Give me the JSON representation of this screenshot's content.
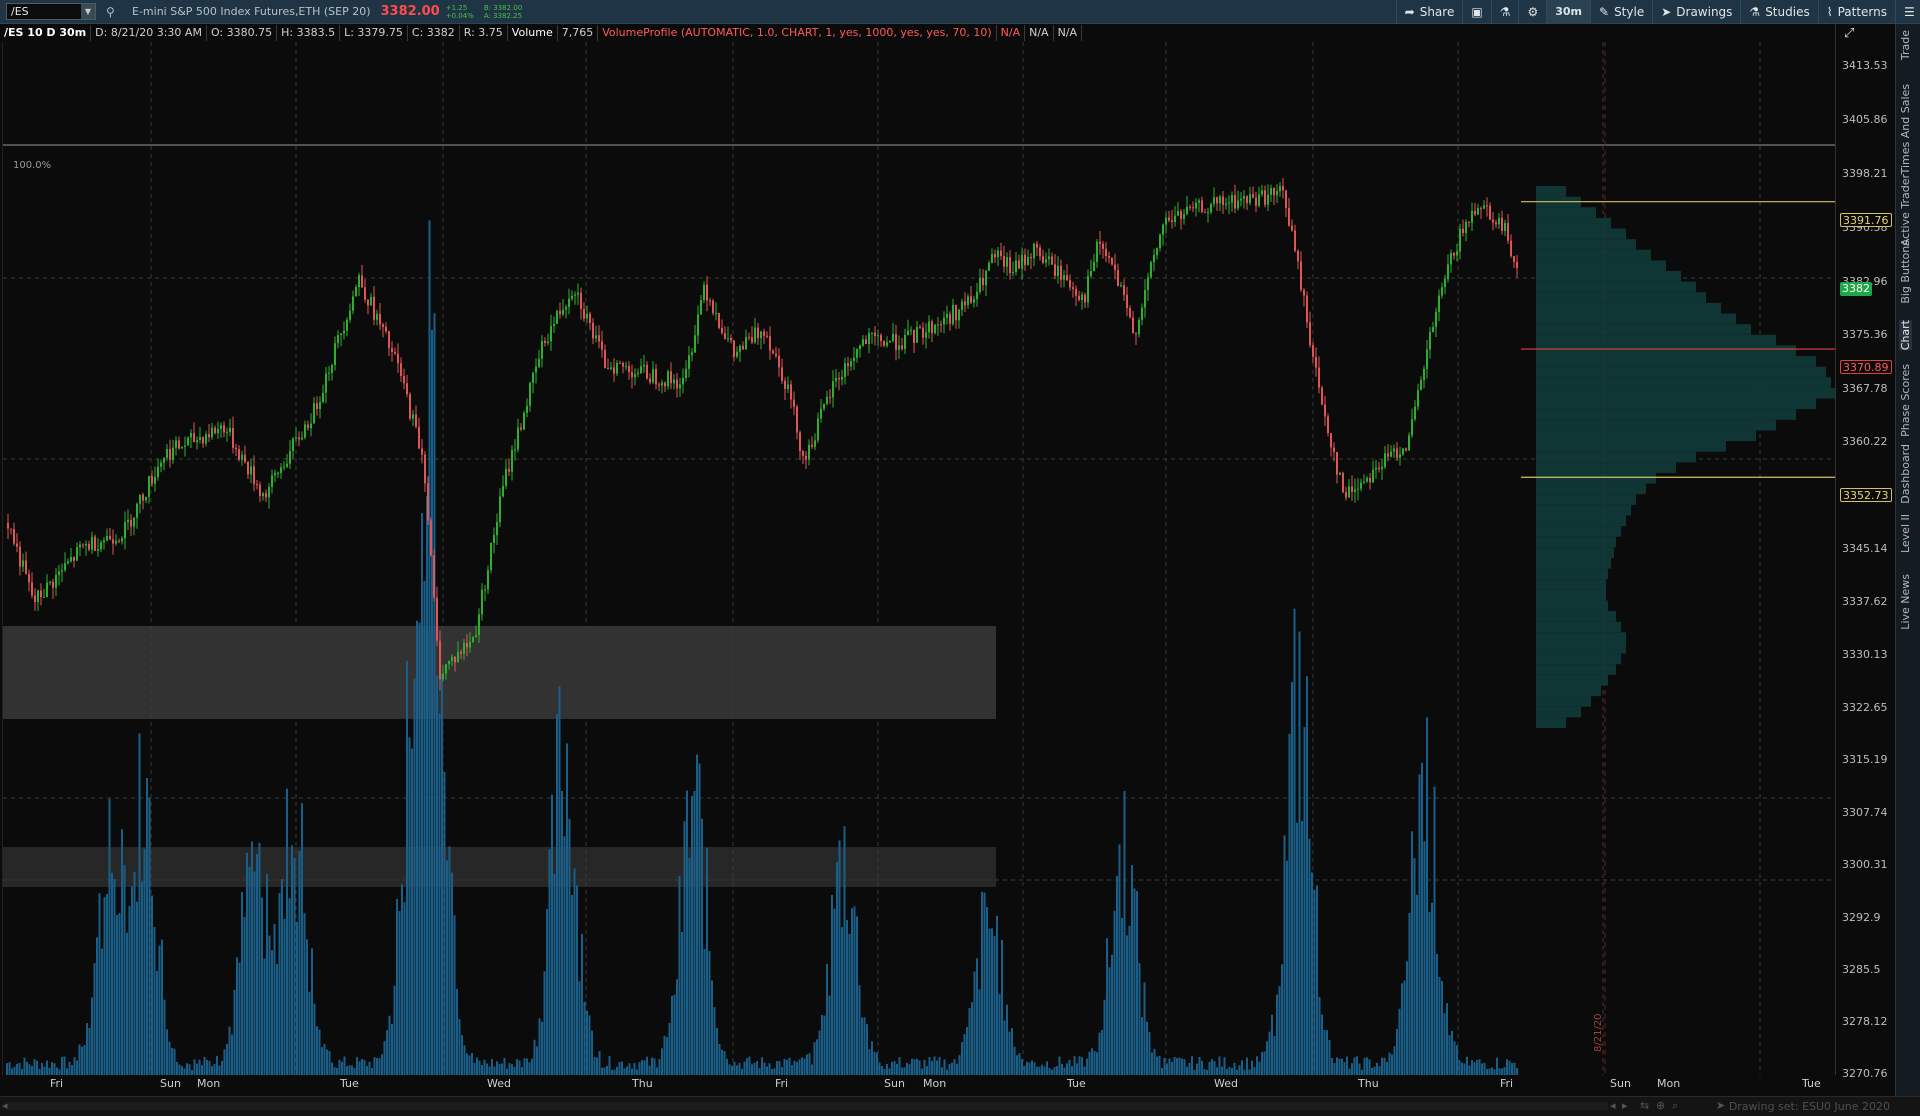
{
  "toolbar": {
    "symbol": "/ES",
    "description": "E-mini S&P 500 Index Futures,ETH (SEP 20)",
    "last_price": "3382.00",
    "net_change": "+1.25",
    "net_change_pct": "+0.04%",
    "bid": "B: 3382.00",
    "ask": "A: 3382.25",
    "buttons": {
      "share": "Share",
      "aggregation": "30m",
      "style": "Style",
      "drawings": "Drawings",
      "studies": "Studies",
      "patterns": "Patterns"
    },
    "icons": [
      "link-icon",
      "share-icon",
      "screenshot-icon",
      "flask-icon",
      "gear-icon",
      "style-icon",
      "cursor-icon",
      "studies-flask-icon",
      "patterns-icon",
      "menu-icon"
    ]
  },
  "infobar": {
    "title": "/ES 10 D 30m",
    "date": "D: 8/21/20 3:30 AM",
    "open": "O: 3380.75",
    "high": "H: 3383.5",
    "low": "L: 3379.75",
    "close": "C: 3382",
    "range": "R: 3.75",
    "volume_label": "Volume",
    "volume_value": "7,765",
    "study": "VolumeProfile (AUTOMATIC, 1.0, CHART, 1, yes, 1000, yes, yes, 70, 10)",
    "na1": "N/A",
    "na2": "N/A",
    "na3": "N/A"
  },
  "chart": {
    "percent_label": "100.0%",
    "expansion_date_label": "8/21/20",
    "colors": {
      "up_candle": "#2db02d",
      "down_candle": "#e05555",
      "volume": "#1a5f8a",
      "profile": "#0f3a3a",
      "value_area_line": "#d8c060",
      "poc_line": "#e04040",
      "gray_zone": "#3a3a3a"
    }
  },
  "price_axis": {
    "ticks": [
      "3413.53",
      "3405.86",
      "3398.21",
      "3390.58",
      "3382.96",
      "3375.36",
      "3367.78",
      "3360.22",
      "3352.68",
      "3345.14",
      "3337.62",
      "3330.13",
      "3322.65",
      "3315.19",
      "3307.74",
      "3300.31",
      "3292.9",
      "3285.5",
      "3278.12",
      "3270.76"
    ],
    "flag_vah": "3391.76",
    "flag_last": "3382",
    "flag_poc": "3370.89",
    "flag_val": "3352.73"
  },
  "time_axis": {
    "labels": [
      "Fri",
      "Sun",
      "Mon",
      "Tue",
      "Wed",
      "Thu",
      "Fri",
      "Sun",
      "Mon",
      "Tue",
      "Wed",
      "Thu",
      "Fri",
      "Sun",
      "Mon",
      "Tue"
    ]
  },
  "side_tabs": [
    "Trade",
    "Times And Sales",
    "Active Trader",
    "Big Buttons",
    "Chart",
    "Phase Scores",
    "Dashboard",
    "Level II",
    "Live News"
  ],
  "status": {
    "drawing_set": "Drawing set: ESU0 June 2020"
  }
}
